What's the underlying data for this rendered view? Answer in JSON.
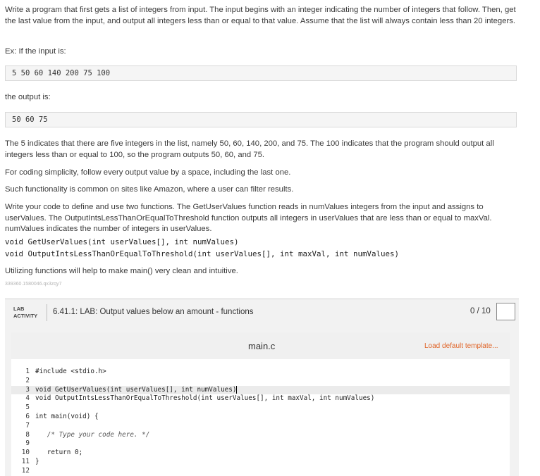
{
  "instructions": {
    "p1": "Write a program that first gets a list of integers from input. The input begins with an integer indicating the number of integers that follow. Then, get the last value from the input, and output all integers less than or equal to that value. Assume that the list will always contain less than 20 integers.",
    "ex_label": "Ex: If the input is:",
    "sample_input": "5 50 60 140 200 75 100",
    "output_label": "the output is:",
    "sample_output": "50 60 75",
    "p2": "The 5 indicates that there are five integers in the list, namely 50, 60, 140, 200, and 75. The 100 indicates that the program should output all integers less than or equal to 100, so the program outputs 50, 60, and 75.",
    "p3": "For coding simplicity, follow every output value by a space, including the last one.",
    "p4": "Such functionality is common on sites like Amazon, where a user can filter results.",
    "p5": "Write your code to define and use two functions. The GetUserValues function reads in numValues integers from the input and assigns to userValues. The OutputIntsLessThanOrEqualToThreshold function outputs all integers in userValues that are less than or equal to maxVal. numValues indicates the number of integers in userValues.",
    "decl1": "void GetUserValues(int userValues[], int numValues)",
    "decl2": "void OutputIntsLessThanOrEqualToThreshold(int userValues[], int maxVal, int numValues)",
    "p6": "Utilizing functions will help to make main() very clean and intuitive.",
    "tracking_id": "339360.1580046.qx3zqy7"
  },
  "lab": {
    "tag_line1": "LAB",
    "tag_line2": "ACTIVITY",
    "title": "6.41.1: LAB: Output values below an amount - functions",
    "score": "0 / 10"
  },
  "editor": {
    "file_name": "main.c",
    "load_template": "Load default template...",
    "lines": [
      {
        "n": "1",
        "code": "#include <stdio.h>"
      },
      {
        "n": "2",
        "code": ""
      },
      {
        "n": "3",
        "code": "void GetUserValues(int userValues[], int numValues)"
      },
      {
        "n": "4",
        "code": "void OutputIntsLessThanOrEqualToThreshold(int userValues[], int maxVal, int numValues)"
      },
      {
        "n": "5",
        "code": ""
      },
      {
        "n": "6",
        "code": "int main(void) {"
      },
      {
        "n": "7",
        "code": ""
      },
      {
        "n": "8",
        "code": "   /* Type your code here. */"
      },
      {
        "n": "9",
        "code": ""
      },
      {
        "n": "10",
        "code": "   return 0;"
      },
      {
        "n": "11",
        "code": "}"
      },
      {
        "n": "12",
        "code": ""
      }
    ]
  }
}
